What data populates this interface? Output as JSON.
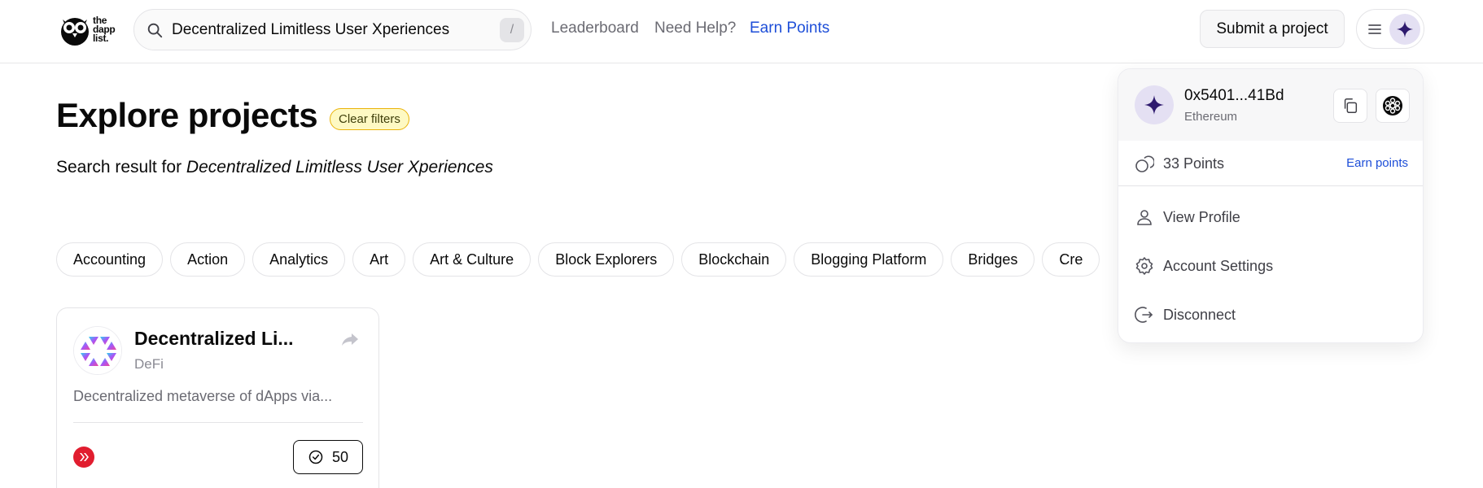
{
  "brand": {
    "logo_lines": [
      "the",
      "dapp",
      "list."
    ]
  },
  "search": {
    "value": "Decentralized Limitless User Xperiences",
    "shortcut": "/"
  },
  "nav": {
    "leaderboard": "Leaderboard",
    "help": "Need Help?",
    "earn": "Earn Points"
  },
  "header": {
    "submit_label": "Submit a project"
  },
  "main": {
    "title": "Explore projects",
    "clear_filters": "Clear filters",
    "search_result_prefix": "Search result for",
    "search_result_query": "Decentralized Limitless User Xperiences"
  },
  "categories": [
    "Accounting",
    "Action",
    "Analytics",
    "Art",
    "Art & Culture",
    "Block Explorers",
    "Blockchain",
    "Blogging Platform",
    "Bridges",
    "Cre"
  ],
  "card": {
    "name": "Decentralized Li...",
    "category": "DeFi",
    "description": "Decentralized metaverse of dApps via...",
    "votes": "50"
  },
  "account_menu": {
    "address": "0x5401...41Bd",
    "network": "Ethereum",
    "points": "33 Points",
    "earn_points": "Earn points",
    "items": [
      {
        "label": "View Profile",
        "icon": "user-icon"
      },
      {
        "label": "Account Settings",
        "icon": "gear-icon"
      },
      {
        "label": "Disconnect",
        "icon": "logout-icon"
      }
    ]
  },
  "colors": {
    "accent_blue": "#1d4ed8",
    "avatar_star": "#2e1a6e",
    "badge_yellow": "#fef9c3",
    "chain_red": "#e11d2f"
  }
}
